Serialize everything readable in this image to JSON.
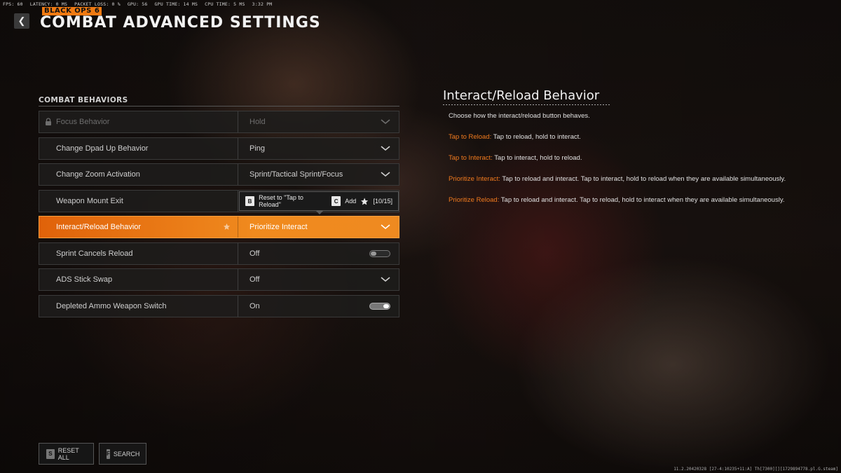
{
  "perf": {
    "fps_label": "FPS:",
    "fps": "60",
    "latency_label": "LATENCY:",
    "latency": "0 MS",
    "packet_loss_label": "PACKET LOSS:",
    "packet_loss": "0 %",
    "gpu_label": "GPU:",
    "gpu": "56",
    "gpu_time_label": "GPU TIME:",
    "gpu_time": "14 MS",
    "cpu_time_label": "CPU TIME:",
    "cpu_time": "5 MS",
    "clock": "3:32 PM"
  },
  "header": {
    "back_glyph": "❮",
    "game_logo": "BLACK OPS 6",
    "title": "COMBAT ADVANCED SETTINGS"
  },
  "section": {
    "title": "COMBAT BEHAVIORS"
  },
  "settings": [
    {
      "label": "Focus Behavior",
      "value": "Hold",
      "control": "dropdown",
      "disabled": true
    },
    {
      "label": "Change Dpad Up Behavior",
      "value": "Ping",
      "control": "dropdown"
    },
    {
      "label": "Change Zoom Activation",
      "value": "Sprint/Tactical Sprint/Focus",
      "control": "dropdown"
    },
    {
      "label": "Weapon Mount Exit",
      "value": "",
      "control": "dropdown"
    },
    {
      "label": "Interact/Reload Behavior",
      "value": "Prioritize Interact",
      "control": "dropdown",
      "selected": true,
      "favorite": true
    },
    {
      "label": "Sprint Cancels Reload",
      "value": "Off",
      "control": "toggle",
      "on": false
    },
    {
      "label": "ADS Stick Swap",
      "value": "Off",
      "control": "dropdown"
    },
    {
      "label": "Depleted Ammo Weapon Switch",
      "value": "On",
      "control": "toggle",
      "on": true
    }
  ],
  "tooltip": {
    "reset_key": "B",
    "reset_label": "Reset to \"Tap to Reload\"",
    "add_key": "C",
    "add_label": "Add",
    "favorites_count": "[10/15]"
  },
  "detail": {
    "title": "Interact/Reload Behavior",
    "description": "Choose how the interact/reload button behaves.",
    "options": [
      {
        "name": "Tap to Reload:",
        "text": " Tap to reload, hold to interact."
      },
      {
        "name": "Tap to Interact:",
        "text": " Tap to interact, hold to reload."
      },
      {
        "name": "Prioritize Interact:",
        "text": " Tap to reload and interact. Tap to interact, hold to reload when they are available simultaneously."
      },
      {
        "name": "Prioritize Reload:",
        "text": " Tap to reload and interact. Tap to reload, hold to interact when they are available simultaneously."
      }
    ]
  },
  "footer": {
    "reset_all_key": "S",
    "reset_all_label": "RESET ALL",
    "search_key": "F",
    "search_label": "SEARCH"
  },
  "build": "11.2.20420328 [27-4:10235+11:A] Th[7300][][1729894778.pl.G.steam]",
  "colors": {
    "accent": "#f07a12",
    "highlight_text": "#f07a1e"
  }
}
